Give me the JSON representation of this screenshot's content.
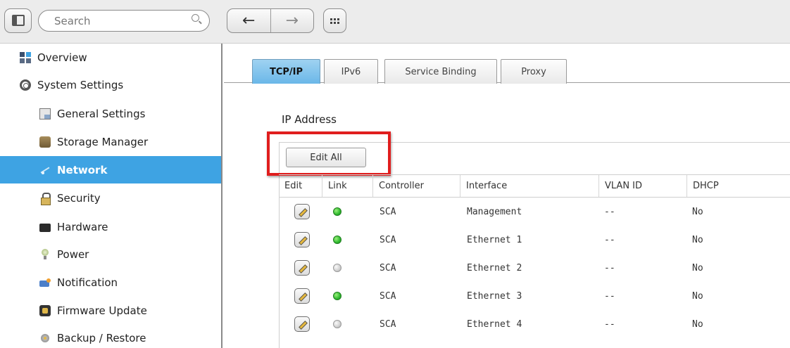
{
  "toolbar": {
    "search_placeholder": "Search",
    "back_glyph": "←",
    "forward_glyph": "→"
  },
  "sidebar": {
    "items": [
      {
        "label": "Overview",
        "icon": "overview-icon",
        "level": "top",
        "active": false
      },
      {
        "label": "System Settings",
        "icon": "gear-icon",
        "level": "top",
        "active": false
      },
      {
        "label": "General Settings",
        "icon": "general-settings-icon",
        "level": "sub",
        "active": false
      },
      {
        "label": "Storage Manager",
        "icon": "storage-icon",
        "level": "sub",
        "active": false
      },
      {
        "label": "Network",
        "icon": "network-icon",
        "level": "sub",
        "active": true
      },
      {
        "label": "Security",
        "icon": "lock-icon",
        "level": "sub",
        "active": false
      },
      {
        "label": "Hardware",
        "icon": "hardware-icon",
        "level": "sub",
        "active": false
      },
      {
        "label": "Power",
        "icon": "lightbulb-icon",
        "level": "sub",
        "active": false
      },
      {
        "label": "Notification",
        "icon": "notification-icon",
        "level": "sub",
        "active": false
      },
      {
        "label": "Firmware Update",
        "icon": "firmware-icon",
        "level": "sub",
        "active": false
      },
      {
        "label": "Backup / Restore",
        "icon": "backup-icon",
        "level": "sub",
        "active": false
      }
    ]
  },
  "tabs": [
    {
      "label": "TCP/IP",
      "active": true
    },
    {
      "label": "IPv6",
      "active": false
    },
    {
      "label": "Service Binding",
      "active": false
    },
    {
      "label": "Proxy",
      "active": false
    }
  ],
  "section_title": "IP Address",
  "edit_all_label": "Edit All",
  "table": {
    "headers": [
      "Edit",
      "Link",
      "Controller",
      "Interface",
      "VLAN ID",
      "DHCP"
    ],
    "rows": [
      {
        "link": "up",
        "controller": "SCA",
        "interface": "Management",
        "vlan": "--",
        "dhcp": "No"
      },
      {
        "link": "up",
        "controller": "SCA",
        "interface": "Ethernet 1",
        "vlan": "--",
        "dhcp": "No"
      },
      {
        "link": "down",
        "controller": "SCA",
        "interface": "Ethernet 2",
        "vlan": "--",
        "dhcp": "No"
      },
      {
        "link": "up",
        "controller": "SCA",
        "interface": "Ethernet 3",
        "vlan": "--",
        "dhcp": "No"
      },
      {
        "link": "down",
        "controller": "SCA",
        "interface": "Ethernet 4",
        "vlan": "--",
        "dhcp": "No"
      }
    ]
  },
  "colors": {
    "accent": "#3ea3e3",
    "highlight": "#e01e1e",
    "link_up": "#2eb82e",
    "link_down": "#cfcfcf"
  }
}
